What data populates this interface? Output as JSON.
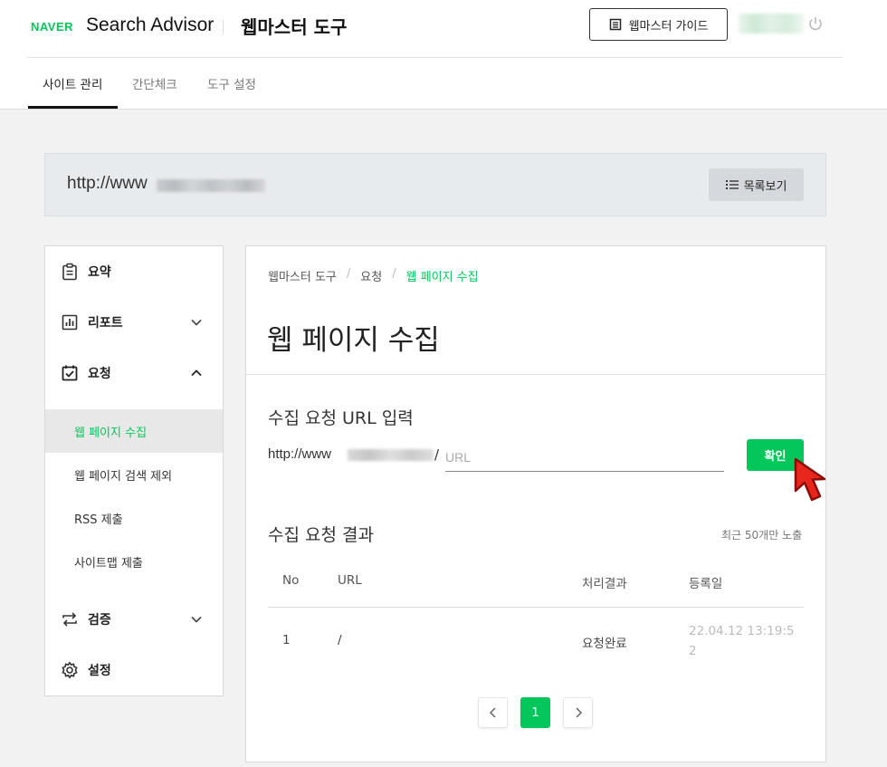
{
  "header": {
    "logo_text": "NAVER",
    "brand": "Search Advisor",
    "subtitle": "웹마스터 도구",
    "guide_button": "웹마스터 가이드"
  },
  "tabs": [
    {
      "label": "사이트 관리",
      "active": true
    },
    {
      "label": "간단체크",
      "active": false
    },
    {
      "label": "도구 설정",
      "active": false
    }
  ],
  "site": {
    "url_prefix": "http://www",
    "list_button": "목록보기"
  },
  "sidebar": {
    "items": [
      {
        "label": "요약",
        "icon": "clipboard-icon"
      },
      {
        "label": "리포트",
        "icon": "bar-chart-icon",
        "expand": "chevron-down-icon"
      },
      {
        "label": "요청",
        "icon": "checked-calendar-icon",
        "expand": "chevron-up-icon"
      },
      {
        "label": "검증",
        "icon": "sync-arrows-icon",
        "expand": "chevron-down-icon"
      },
      {
        "label": "설정",
        "icon": "gear-icon"
      }
    ],
    "sub_items": [
      {
        "label": "웹 페이지 수집",
        "active": true
      },
      {
        "label": "웹 페이지 검색 제외",
        "active": false
      },
      {
        "label": "RSS 제출",
        "active": false
      },
      {
        "label": "사이트맵 제출",
        "active": false
      }
    ]
  },
  "breadcrumb": {
    "items": [
      "웹마스터 도구",
      "요청",
      "웹 페이지 수집"
    ],
    "separator": "/"
  },
  "page_title": "웹 페이지 수집",
  "request_form": {
    "title": "수집 요청 URL 입력",
    "url_prefix": "http://www",
    "url_suffix": "/",
    "placeholder": "URL",
    "value": "",
    "confirm_button": "확인"
  },
  "results": {
    "title": "수집 요청 결과",
    "note": "최근 50개만 노출",
    "columns": [
      "No",
      "URL",
      "처리결과",
      "등록일"
    ],
    "rows": [
      {
        "no": "1",
        "url": "/",
        "status": "요청완료",
        "date": "22.04.12 13:19:52"
      }
    ]
  },
  "pagination": {
    "current": "1",
    "prev_icon": "chevron-left-icon",
    "next_icon": "chevron-right-icon"
  },
  "colors": {
    "brand_green": "#03c75a",
    "cursor_red": "#e8261c"
  }
}
